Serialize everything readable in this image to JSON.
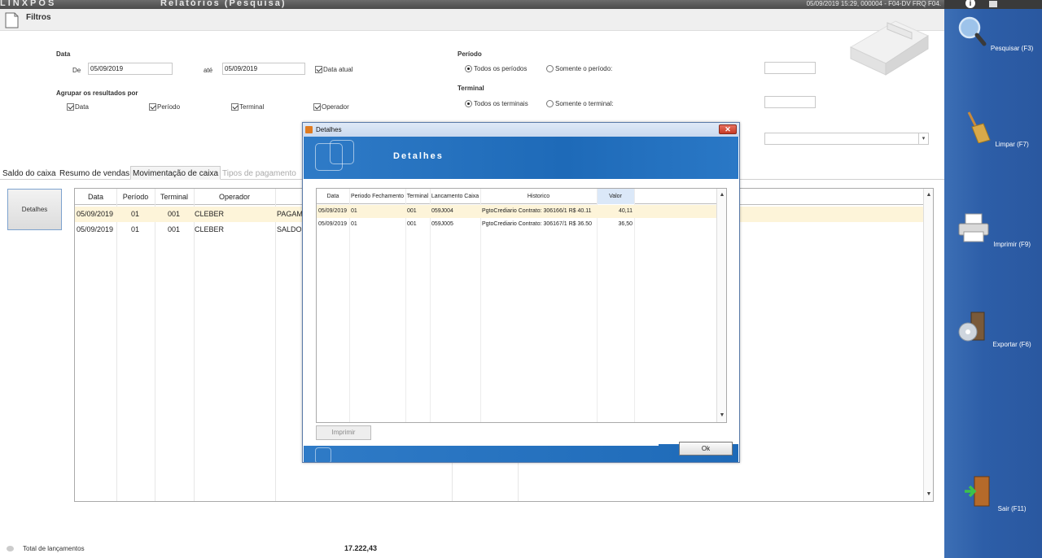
{
  "app": {
    "logo": "LINXPOS",
    "title": "Relatórios (Pesquisa)",
    "status": "05/09/2019 15:29, 000004 - F04-DV FRQ F04."
  },
  "filtros": {
    "label": "Filtros",
    "data_label": "Data",
    "de_label": "De",
    "de_value": "05/09/2019",
    "ate_label": "até",
    "ate_value": "05/09/2019",
    "data_atual_label": "Data atual",
    "agrupar_label": "Agrupar os resultados por",
    "agrupar": [
      "Data",
      "Período",
      "Terminal",
      "Operador"
    ],
    "periodo_label": "Período",
    "periodo_todos": "Todos os períodos",
    "periodo_somente": "Somente o período:",
    "terminal_label": "Terminal",
    "terminal_todos": "Todos os terminais",
    "terminal_somente": "Somente o terminal:"
  },
  "tabs": [
    "Saldo do caixa",
    "Resumo de vendas",
    "Movimentação de caixa",
    "Tipos de pagamento"
  ],
  "detalhes_button": "Detalhes",
  "grid": {
    "columns": [
      "Data",
      "Período",
      "Terminal",
      "Operador"
    ],
    "rows": [
      {
        "data": "05/09/2019",
        "periodo": "01",
        "terminal": "001",
        "operador": "CLEBER",
        "extra": "PAGAME"
      },
      {
        "data": "05/09/2019",
        "periodo": "01",
        "terminal": "001",
        "operador": "CLEBER",
        "extra": "SALDO I"
      }
    ]
  },
  "footer": {
    "total_label": "Total de lançamentos",
    "total_value": "17.222,43"
  },
  "sidebar": [
    {
      "label": "Pesquisar (F3)",
      "icon": "magnifier-icon"
    },
    {
      "label": "Limpar (F7)",
      "icon": "broom-icon"
    },
    {
      "label": "Imprimir (F9)",
      "icon": "printer-icon"
    },
    {
      "label": "Exportar (F6)",
      "icon": "export-disc-icon"
    },
    {
      "label": "Sair (F11)",
      "icon": "exit-door-icon"
    }
  ],
  "modal": {
    "title": "Detalhes",
    "banner": "Detalhes",
    "columns": [
      "Data",
      "Periodo Fechamento",
      "Terminal",
      "Lancamento Caixa",
      "Historico",
      "Valor"
    ],
    "rows": [
      {
        "data": "05/09/2019",
        "periodo": "01",
        "terminal": "001",
        "lancamento": "059J004",
        "historico": "PgtoCrediario Contrato: 306166/1 R$ 40.11",
        "valor": "40,11"
      },
      {
        "data": "05/09/2019",
        "periodo": "01",
        "terminal": "001",
        "lancamento": "059J005",
        "historico": "PgtoCrediario Contrato: 306167/1 R$ 36.50",
        "valor": "36,50"
      }
    ],
    "print_button": "Imprimir",
    "ok_button": "Ok"
  },
  "colors": {
    "sidebar_blue": "#2d5ea8",
    "banner_blue": "#1e6ab8",
    "selected_row": "#fdf4d9"
  }
}
